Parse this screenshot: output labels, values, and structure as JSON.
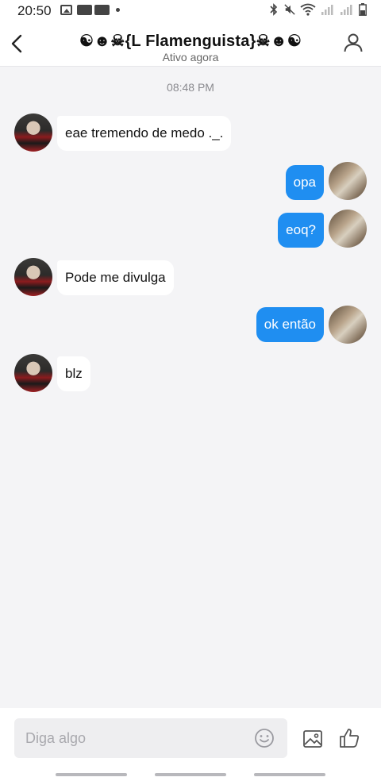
{
  "status_bar": {
    "time": "20:50",
    "icons": [
      "gallery-icon",
      "chip-icon",
      "chip-icon",
      "dot-icon",
      "bluetooth-icon",
      "mute-icon",
      "wifi-icon",
      "signal-icon",
      "signal-icon",
      "battery-icon"
    ]
  },
  "header": {
    "title": "☯☻☠{L Flamenguista}☠☻☯",
    "subtitle": "Ativo agora",
    "icons": [
      "back-arrow-icon",
      "profile-icon"
    ]
  },
  "conversation": {
    "timestamp": "08:48 PM",
    "messages": [
      {
        "from": "other",
        "text": "eae tremendo de medo ._."
      },
      {
        "from": "self",
        "text": "opa"
      },
      {
        "from": "self",
        "text": "eoq?"
      },
      {
        "from": "other",
        "text": "Pode me divulga"
      },
      {
        "from": "self",
        "text": "ok então"
      },
      {
        "from": "other",
        "text": "blz"
      }
    ]
  },
  "composer": {
    "placeholder": "Diga algo",
    "value": "",
    "icons": [
      "emoji-icon",
      "image-icon",
      "thumbs-up-icon"
    ]
  },
  "colors": {
    "outgoing_bubble": "#1f8ef1",
    "incoming_bubble": "#ffffff",
    "background": "#f4f4f6"
  }
}
